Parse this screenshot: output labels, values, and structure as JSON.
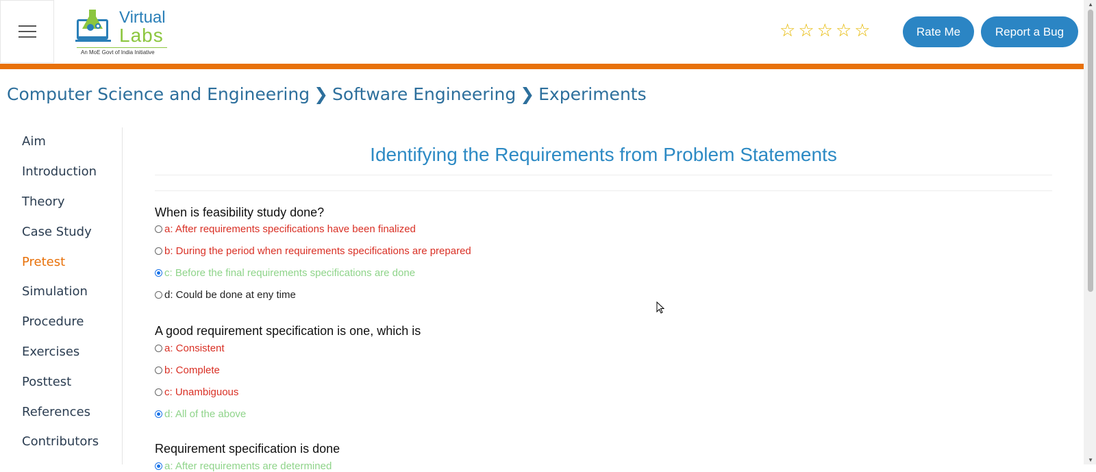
{
  "header": {
    "brand_line1": "Virtual",
    "brand_line2": "Labs",
    "tagline": "An MoE Govt of India Initiative",
    "rating_stars": [
      "☆",
      "☆",
      "☆",
      "☆",
      "☆"
    ],
    "rate_button": "Rate Me",
    "bug_button": "Report a Bug",
    "accent_color": "#e8710a",
    "button_color": "#2b85c4"
  },
  "breadcrumb": {
    "items": [
      "Computer Science and Engineering",
      "Software Engineering",
      "Experiments"
    ],
    "separator": "❯"
  },
  "sidebar": {
    "items": [
      {
        "label": "Aim"
      },
      {
        "label": "Introduction"
      },
      {
        "label": "Theory"
      },
      {
        "label": "Case Study"
      },
      {
        "label": "Pretest",
        "active": true
      },
      {
        "label": "Simulation"
      },
      {
        "label": "Procedure"
      },
      {
        "label": "Exercises"
      },
      {
        "label": "Posttest"
      },
      {
        "label": "References"
      },
      {
        "label": "Contributors"
      }
    ]
  },
  "main": {
    "title": "Identifying the Requirements from Problem Statements",
    "questions": [
      {
        "text": "When is feasibility study done?",
        "options": [
          {
            "label": "a: After requirements specifications have been finalized",
            "state": "wrong",
            "checked": false
          },
          {
            "label": "b: During the period when requirements specifications are prepared",
            "state": "wrong",
            "checked": false
          },
          {
            "label": "c: Before the final requirements specifications are done",
            "state": "correct",
            "checked": true
          },
          {
            "label": "d: Could be done at eny time",
            "state": "neutral",
            "checked": false
          }
        ]
      },
      {
        "text": "A good requirement specification is one, which is",
        "options": [
          {
            "label": "a: Consistent",
            "state": "wrong",
            "checked": false
          },
          {
            "label": "b: Complete",
            "state": "wrong",
            "checked": false
          },
          {
            "label": "c: Unambiguous",
            "state": "wrong",
            "checked": false
          },
          {
            "label": "d: All of the above",
            "state": "correct",
            "checked": true
          }
        ]
      },
      {
        "text": "Requirement specification is done",
        "options": [
          {
            "label": "a: After requirements are determined",
            "state": "correct",
            "checked": true
          }
        ]
      }
    ]
  }
}
